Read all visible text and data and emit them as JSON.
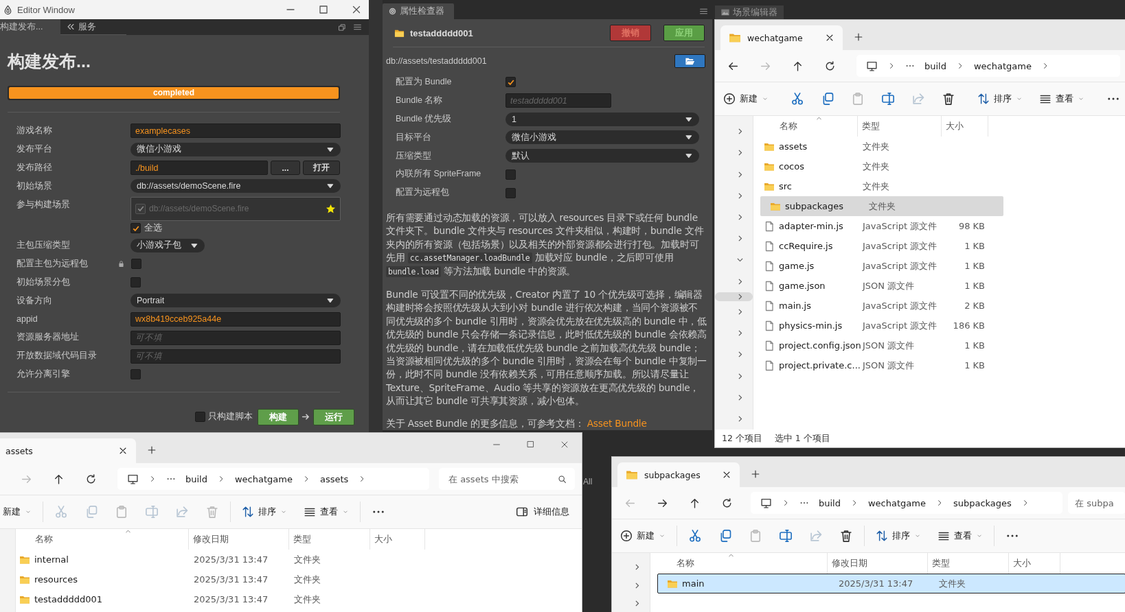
{
  "editor_window": {
    "title": "Editor Window",
    "tabs": [
      {
        "label": "构建发布...",
        "selected": true
      },
      {
        "label": "服务",
        "selected": false
      }
    ],
    "heading": "构建发布...",
    "progress": {
      "label": "completed",
      "level": 1
    },
    "fields": [
      {
        "kind": "text",
        "label": "游戏名称",
        "value": "examplecases"
      },
      {
        "kind": "select",
        "label": "发布平台",
        "value": "微信小游戏"
      },
      {
        "kind": "path",
        "label": "发布路径",
        "value": "./build",
        "buttons": [
          "...",
          "打开"
        ]
      },
      {
        "kind": "select",
        "label": "初始场景",
        "value": "db://assets/demoScene.fire"
      },
      {
        "kind": "scenes",
        "label": "参与构建场景",
        "scenes": [
          {
            "path": "db://assets/demoScene.fire",
            "checked": true,
            "starred": true
          }
        ],
        "select_all": {
          "label": "全选",
          "checked": true
        }
      },
      {
        "kind": "select_short",
        "label": "主包压缩类型",
        "value": "小游戏子包"
      },
      {
        "kind": "checkbox",
        "label": "配置主包为远程包",
        "checked": false,
        "locked": true
      },
      {
        "kind": "checkbox",
        "label": "初始场景分包",
        "checked": false
      },
      {
        "kind": "select",
        "label": "设备方向",
        "value": "Portrait"
      },
      {
        "kind": "text",
        "label": "appid",
        "value": "wx8b419cceb925a44e"
      },
      {
        "kind": "text",
        "label": "资源服务器地址",
        "placeholder": "可不填"
      },
      {
        "kind": "text",
        "label": "开放数据域代码目录",
        "placeholder": "可不填"
      },
      {
        "kind": "checkbox",
        "label": "允许分离引擎",
        "checked": false
      }
    ],
    "script_only": {
      "label": "只构建脚本",
      "checked": false
    },
    "build_button": "构建",
    "run_button": "运行"
  },
  "inspector": {
    "tab": "属性检查器",
    "asset_name": "testaddddd001",
    "revert_button": {
      "label": "撤销",
      "disabled": true
    },
    "apply_button": {
      "label": "应用",
      "disabled": true
    },
    "path": "db://assets/testaddddd001",
    "fields": [
      {
        "kind": "checkbox",
        "label": "配置为 Bundle",
        "checked": true
      },
      {
        "kind": "short_text",
        "label": "Bundle 名称",
        "placeholder": "testaddddd001"
      },
      {
        "kind": "select",
        "label": "Bundle 优先级",
        "value": "1"
      },
      {
        "kind": "select",
        "label": "目标平台",
        "value": "微信小游戏"
      },
      {
        "kind": "select",
        "label": "压缩类型",
        "value": "默认"
      },
      {
        "kind": "checkbox",
        "label": "内联所有 SpriteFrame",
        "checked": false
      },
      {
        "kind": "checkbox",
        "label": "配置为远程包",
        "checked": false
      }
    ],
    "paragraphs": [
      [
        {
          "kind": "text",
          "text": "所有需要通过动态加载的资源，可以放入 resources 目录下或任何 bundle 文件夹下。bundle 文件夹与 resources 文件夹相似，构建时，bundle 文件夹内的所有资源（包括场景）以及相关的外部资源都会进行打包。加载时可先用 "
        },
        {
          "kind": "code",
          "text": "cc.assetManager.loadBundle"
        },
        {
          "kind": "text",
          "text": " 加载对应 bundle，之后即可使用 "
        },
        {
          "kind": "code",
          "text": "bundle.load"
        },
        {
          "kind": "text",
          "text": " 等方法加载 bundle 中的资源。"
        }
      ],
      [
        {
          "kind": "text",
          "text": "Bundle 可设置不同的优先级，Creator 内置了 10 个优先级可选择，编辑器构建时将会按照优先级从大到小对 bundle 进行依次构建，当同个资源被不同优先级的多个 bundle 引用时，资源会优先放在优先级高的 bundle 中，低优先级的 bundle 只会存储一条记录信息，此时低优先级的 bundle 会依赖高优先级的 bundle，请在加载低优先级 bundle 之前加载高优先级 bundle；当资源被相同优先级的多个 bundle 引用时，资源会在每个 bundle 中复制一份，此时不同 bundle 没有依赖关系，可用任意顺序加载。所以请尽量让 Texture、SpriteFrame、Audio 等共享的资源放在更高优先级的 bundle，从而让其它 bundle 可共享其资源，减小包体。"
        }
      ],
      [
        {
          "kind": "text",
          "text": "关于 Asset Bundle 的更多信息，可参考文档： "
        },
        {
          "kind": "link",
          "text": "Asset Bundle"
        }
      ]
    ]
  },
  "scene_editor_tab": "场景编辑器",
  "background_label": "All",
  "explorers": [
    {
      "tab": "wechatgame",
      "focused": false,
      "nav": [
        {
          "kind": "back",
          "disabled": false
        },
        {
          "kind": "forward",
          "disabled": true
        },
        {
          "kind": "up",
          "disabled": false
        },
        {
          "kind": "refresh",
          "disabled": false
        }
      ],
      "breadcrumb": [
        "build",
        "wechatgame"
      ],
      "toolbar": [
        {
          "kind": "new",
          "label": "新建",
          "disabled": false
        },
        {
          "kind": "cut",
          "disabled": false
        },
        {
          "kind": "copy",
          "disabled": false
        },
        {
          "kind": "paste",
          "disabled": true
        },
        {
          "kind": "rename",
          "disabled": false
        },
        {
          "kind": "share",
          "disabled": true
        },
        {
          "kind": "delete",
          "disabled": false
        },
        {
          "kind": "sort",
          "label": "排序",
          "disabled": false
        },
        {
          "kind": "view",
          "label": "查看",
          "disabled": false
        },
        {
          "kind": "more",
          "disabled": false
        }
      ],
      "nav_pane": [
        {
          "expanded": false,
          "selected": false
        },
        {
          "expanded": false,
          "selected": false
        },
        {
          "expanded": false,
          "selected": false
        },
        {
          "expanded": false,
          "selected": false
        },
        {
          "expanded": false,
          "selected": false
        },
        {
          "expanded": false,
          "selected": false
        },
        {
          "expanded": true,
          "selected": false
        },
        {
          "expanded": false,
          "selected": false
        },
        {
          "expanded": false,
          "selected": true
        },
        {
          "expanded": false,
          "selected": false
        },
        {
          "expanded": false,
          "selected": false
        },
        {
          "expanded": false,
          "selected": false
        },
        {
          "expanded": false,
          "selected": false
        },
        {
          "expanded": false,
          "selected": false
        },
        {
          "expanded": false,
          "selected": false
        }
      ],
      "columns": [
        {
          "kind": "name",
          "label": "名称"
        },
        {
          "kind": "type",
          "label": "类型"
        },
        {
          "kind": "size",
          "label": "大小"
        }
      ],
      "rows": [
        {
          "kind": "folder",
          "name": "assets",
          "type": "文件夹",
          "selected": false
        },
        {
          "kind": "folder",
          "name": "cocos",
          "type": "文件夹",
          "selected": false
        },
        {
          "kind": "folder",
          "name": "src",
          "type": "文件夹",
          "selected": false
        },
        {
          "kind": "folder",
          "name": "subpackages",
          "type": "文件夹",
          "selected": true
        },
        {
          "kind": "file",
          "name": "adapter-min.js",
          "type": "JavaScript 源文件",
          "size": "98 KB",
          "selected": false
        },
        {
          "kind": "file",
          "name": "ccRequire.js",
          "type": "JavaScript 源文件",
          "size": "1 KB",
          "selected": false
        },
        {
          "kind": "file",
          "name": "game.js",
          "type": "JavaScript 源文件",
          "size": "1 KB",
          "selected": false
        },
        {
          "kind": "file",
          "name": "game.json",
          "type": "JSON 源文件",
          "size": "1 KB",
          "selected": false
        },
        {
          "kind": "file",
          "name": "main.js",
          "type": "JavaScript 源文件",
          "size": "2 KB",
          "selected": false
        },
        {
          "kind": "file",
          "name": "physics-min.js",
          "type": "JavaScript 源文件",
          "size": "186 KB",
          "selected": false
        },
        {
          "kind": "file",
          "name": "project.config.json",
          "type": "JSON 源文件",
          "size": "1 KB",
          "selected": false
        },
        {
          "kind": "file",
          "name": "project.private.c...",
          "type": "JSON 源文件",
          "size": "1 KB",
          "selected": false
        }
      ],
      "status": [
        "12 个项目",
        "选中 1 个项目"
      ]
    },
    {
      "tab": "assets",
      "window_controls": true,
      "nav": [
        {
          "kind": "forward",
          "disabled": true
        },
        {
          "kind": "up",
          "disabled": false
        },
        {
          "kind": "refresh",
          "disabled": false
        }
      ],
      "breadcrumb": [
        "build",
        "wechatgame",
        "assets"
      ],
      "search": {
        "placeholder": "在 assets 中搜索"
      },
      "toolbar": [
        {
          "kind": "new",
          "label": "新建",
          "disabled": false,
          "icon": false
        },
        {
          "kind": "cut",
          "disabled": true
        },
        {
          "kind": "copy",
          "disabled": true
        },
        {
          "kind": "paste",
          "disabled": true
        },
        {
          "kind": "rename",
          "disabled": true
        },
        {
          "kind": "share",
          "disabled": true
        },
        {
          "kind": "delete",
          "disabled": true
        },
        {
          "kind": "sort",
          "label": "排序",
          "disabled": false
        },
        {
          "kind": "view",
          "label": "查看",
          "disabled": false
        },
        {
          "kind": "more",
          "disabled": false
        }
      ],
      "details_button": "详细信息",
      "columns": [
        {
          "kind": "name",
          "label": "名称"
        },
        {
          "kind": "modified",
          "label": "修改日期"
        },
        {
          "kind": "type",
          "label": "类型"
        },
        {
          "kind": "size",
          "label": "大小"
        }
      ],
      "rows": [
        {
          "kind": "folder",
          "name": "internal",
          "modified": "2025/3/31 13:47",
          "type": "文件夹",
          "selected": false
        },
        {
          "kind": "folder",
          "name": "resources",
          "modified": "2025/3/31 13:47",
          "type": "文件夹",
          "selected": false
        },
        {
          "kind": "folder",
          "name": "testaddddd001",
          "modified": "2025/3/31 13:47",
          "type": "文件夹",
          "selected": false
        }
      ]
    },
    {
      "tab": "subpackages",
      "focused": true,
      "nav": [
        {
          "kind": "back",
          "disabled": true
        },
        {
          "kind": "forward",
          "disabled": false
        },
        {
          "kind": "up",
          "disabled": false
        },
        {
          "kind": "refresh",
          "disabled": false
        }
      ],
      "breadcrumb": [
        "build",
        "wechatgame",
        "subpackages"
      ],
      "search": {
        "placeholder": "在 subpa"
      },
      "toolbar": [
        {
          "kind": "new",
          "label": "新建",
          "disabled": false
        },
        {
          "kind": "cut",
          "disabled": false
        },
        {
          "kind": "copy",
          "disabled": false
        },
        {
          "kind": "paste",
          "disabled": true
        },
        {
          "kind": "rename",
          "disabled": false
        },
        {
          "kind": "share",
          "disabled": true
        },
        {
          "kind": "delete",
          "disabled": false
        },
        {
          "kind": "sort",
          "label": "排序",
          "disabled": false
        },
        {
          "kind": "view",
          "label": "查看",
          "disabled": false
        },
        {
          "kind": "more",
          "disabled": false
        }
      ],
      "nav_pane": [
        {
          "expanded": false,
          "selected": false
        },
        {
          "expanded": false,
          "selected": false
        },
        {
          "expanded": false,
          "selected": false
        }
      ],
      "columns": [
        {
          "kind": "name",
          "label": "名称"
        },
        {
          "kind": "modified",
          "label": "修改日期"
        },
        {
          "kind": "type",
          "label": "类型"
        },
        {
          "kind": "size",
          "label": "大小"
        }
      ],
      "rows": [
        {
          "kind": "folder",
          "name": "main",
          "modified": "2025/3/31 13:47",
          "type": "文件夹",
          "selected": true
        }
      ]
    }
  ]
}
